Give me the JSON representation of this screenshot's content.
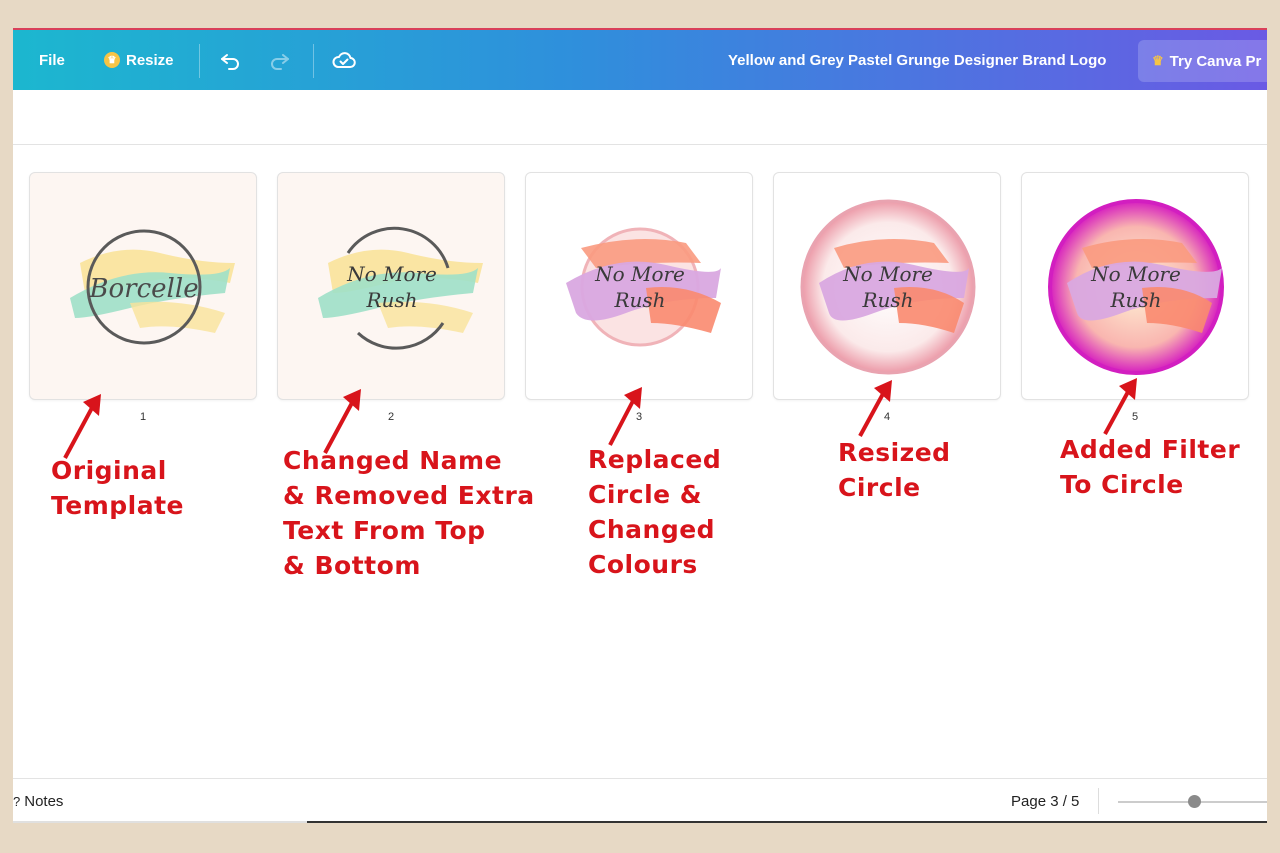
{
  "toolbar": {
    "file_label": "File",
    "resize_label": "Resize",
    "undo_icon": "undo-icon",
    "redo_icon": "redo-icon",
    "cloud_icon": "cloud-check-icon",
    "doc_title": "Yellow and Grey Pastel Grunge Designer Brand Logo",
    "try_pro_label": "Try Canva Pr",
    "gradient_colors": [
      "#1cb7cf",
      "#2f8fdc",
      "#6a5ae4"
    ]
  },
  "pages": [
    {
      "number": "1",
      "logo_line1": "Borcelle",
      "logo_line2": "",
      "caption": [
        "Original",
        "Template"
      ]
    },
    {
      "number": "2",
      "logo_line1": "No More",
      "logo_line2": "Rush",
      "caption": [
        "Changed Name",
        "& Removed Extra",
        "Text From Top",
        "& Bottom"
      ]
    },
    {
      "number": "3",
      "logo_line1": "No More",
      "logo_line2": "Rush",
      "caption": [
        "Replaced",
        "Circle &",
        "Changed",
        "Colours"
      ]
    },
    {
      "number": "4",
      "logo_line1": "No More",
      "logo_line2": "Rush",
      "caption": [
        "Resized",
        "Circle"
      ]
    },
    {
      "number": "5",
      "logo_line1": "No More",
      "logo_line2": "Rush",
      "caption": [
        "Added Filter",
        "To Circle"
      ]
    }
  ],
  "bottom_bar": {
    "notes_label": "Notes",
    "page_indicator": "Page 3 / 5",
    "zoom_fraction": 0.5
  },
  "colors": {
    "annotation_red": "#d8141b",
    "background": "#e7d9c5"
  }
}
